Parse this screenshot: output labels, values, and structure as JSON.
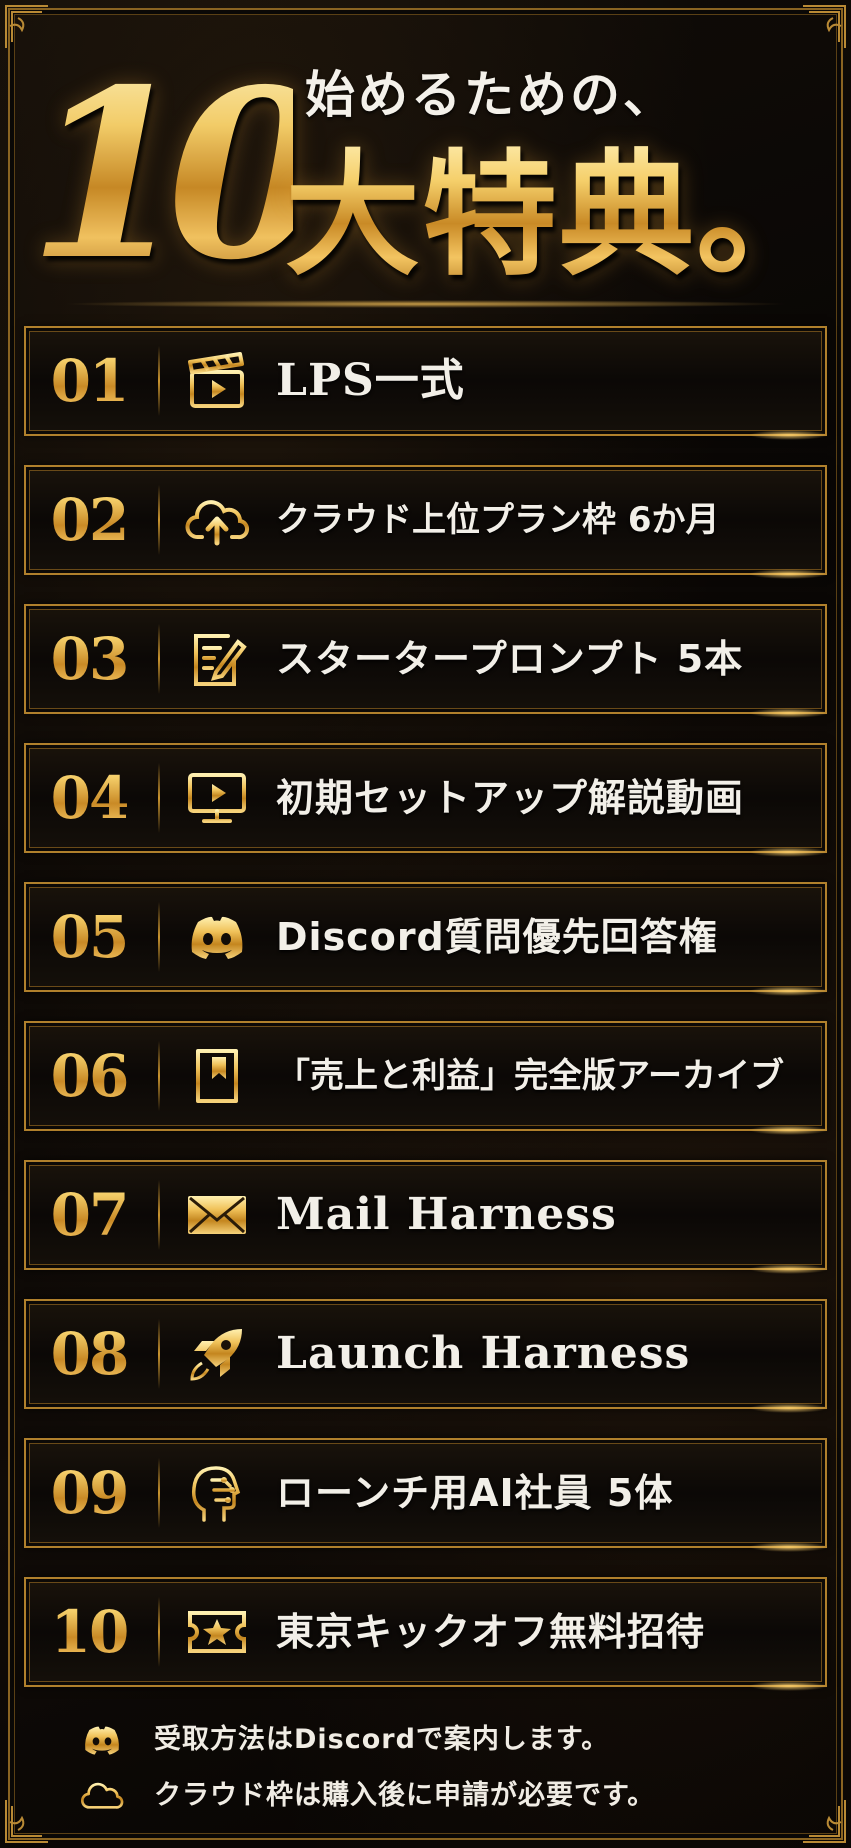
{
  "hero": {
    "number": "10",
    "subtitle": "始めるための、",
    "title": "大特典。"
  },
  "benefits": [
    {
      "num": "01",
      "icon": "clapperboard-icon",
      "label": "LPS一式"
    },
    {
      "num": "02",
      "icon": "cloud-upload-icon",
      "label": "クラウド上位プラン枠 6か月"
    },
    {
      "num": "03",
      "icon": "edit-document-icon",
      "label": "スタータープロンプト 5本"
    },
    {
      "num": "04",
      "icon": "monitor-play-icon",
      "label": "初期セットアップ解説動画"
    },
    {
      "num": "05",
      "icon": "discord-icon",
      "label": "Discord質問優先回答権"
    },
    {
      "num": "06",
      "icon": "bookmark-book-icon",
      "label": "「売上と利益」完全版アーカイブ"
    },
    {
      "num": "07",
      "icon": "envelope-icon",
      "label": "Mail Harness"
    },
    {
      "num": "08",
      "icon": "rocket-icon",
      "label": "Launch Harness"
    },
    {
      "num": "09",
      "icon": "ai-head-icon",
      "label": "ローンチ用AI社員 5体"
    },
    {
      "num": "10",
      "icon": "ticket-star-icon",
      "label": "東京キックオフ無料招待"
    }
  ],
  "footer": {
    "line1": "受取方法はDiscordで案内します。",
    "line2": "クラウド枠は購入後に申請が必要です。"
  },
  "colors": {
    "gold": "#d9a441",
    "gold_light": "#fbe3a0",
    "background": "#0a0806",
    "text": "#f2efe8"
  }
}
